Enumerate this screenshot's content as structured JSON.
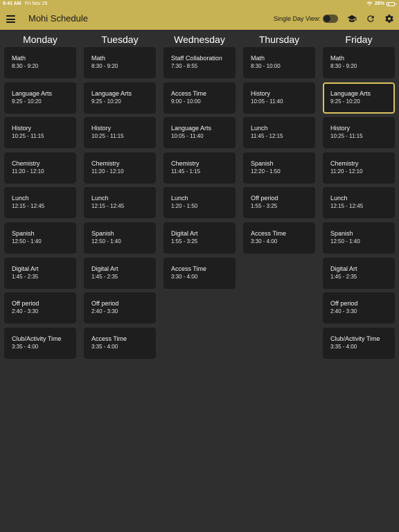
{
  "status_bar": {
    "time": "9:41 AM",
    "date": "Fri Nov 29",
    "battery_percent": "26%",
    "battery_level": 0.26
  },
  "header": {
    "menu_icon": "hamburger-menu-icon",
    "title": "Mohi Schedule",
    "single_day_label": "Single Day View:",
    "single_day_enabled": false,
    "icons": [
      "graduation-cap-icon",
      "refresh-icon",
      "gear-icon"
    ]
  },
  "colors": {
    "header_bg": "#c7b254",
    "page_bg": "#2f2f2f",
    "card_bg": "#1e1e1e",
    "highlight": "#d9c35c"
  },
  "days": [
    {
      "name": "Monday",
      "periods": [
        {
          "name": "Math",
          "time": "8:30 - 9:20"
        },
        {
          "name": "Language Arts",
          "time": "9:25 - 10:20"
        },
        {
          "name": "History",
          "time": "10:25 - 11:15"
        },
        {
          "name": "Chemistry",
          "time": "11:20 - 12:10"
        },
        {
          "name": "Lunch",
          "time": "12:15 - 12:45"
        },
        {
          "name": "Spanish",
          "time": "12:50 - 1:40"
        },
        {
          "name": "Digital Art",
          "time": "1:45 - 2:35"
        },
        {
          "name": "Off period",
          "time": "2:40 - 3:30"
        },
        {
          "name": "Club/Activity Time",
          "time": "3:35 - 4:00"
        }
      ]
    },
    {
      "name": "Tuesday",
      "periods": [
        {
          "name": "Math",
          "time": "8:30 - 9:20"
        },
        {
          "name": "Language Arts",
          "time": "9:25 - 10:20"
        },
        {
          "name": "History",
          "time": "10:25 - 11:15"
        },
        {
          "name": "Chemistry",
          "time": "11:20 - 12:10"
        },
        {
          "name": "Lunch",
          "time": "12:15 - 12:45"
        },
        {
          "name": "Spanish",
          "time": "12:50 - 1:40"
        },
        {
          "name": "Digital Art",
          "time": "1:45 - 2:35"
        },
        {
          "name": "Off period",
          "time": "2:40 - 3:30"
        },
        {
          "name": "Access Time",
          "time": "3:35 - 4:00"
        }
      ]
    },
    {
      "name": "Wednesday",
      "periods": [
        {
          "name": "Staff Collaboration",
          "time": "7:30 - 8:55"
        },
        {
          "name": "Access Time",
          "time": "9:00 - 10:00"
        },
        {
          "name": "Language Arts",
          "time": "10:05 - 11:40"
        },
        {
          "name": "Chemistry",
          "time": "11:45 - 1:15"
        },
        {
          "name": "Lunch",
          "time": "1:20 - 1:50"
        },
        {
          "name": "Digital Art",
          "time": "1:55 - 3:25"
        },
        {
          "name": "Access Time",
          "time": "3:30 - 4:00"
        }
      ]
    },
    {
      "name": "Thursday",
      "periods": [
        {
          "name": "Math",
          "time": "8:30 - 10:00"
        },
        {
          "name": "History",
          "time": "10:05 - 11:40"
        },
        {
          "name": "Lunch",
          "time": "11:45 - 12:15"
        },
        {
          "name": "Spanish",
          "time": "12:20 - 1:50"
        },
        {
          "name": "Off period",
          "time": "1:55 - 3:25"
        },
        {
          "name": "Access Time",
          "time": "3:30 - 4:00"
        }
      ]
    },
    {
      "name": "Friday",
      "periods": [
        {
          "name": "Math",
          "time": "8:30 - 9:20"
        },
        {
          "name": "Language Arts",
          "time": "9:25 - 10:20",
          "current": true
        },
        {
          "name": "History",
          "time": "10:25 - 11:15"
        },
        {
          "name": "Chemistry",
          "time": "11:20 - 12:10"
        },
        {
          "name": "Lunch",
          "time": "12:15 - 12:45"
        },
        {
          "name": "Spanish",
          "time": "12:50 - 1:40"
        },
        {
          "name": "Digital Art",
          "time": "1:45 - 2:35"
        },
        {
          "name": "Off period",
          "time": "2:40 - 3:30"
        },
        {
          "name": "Club/Activity Time",
          "time": "3:35 - 4:00"
        }
      ]
    }
  ]
}
